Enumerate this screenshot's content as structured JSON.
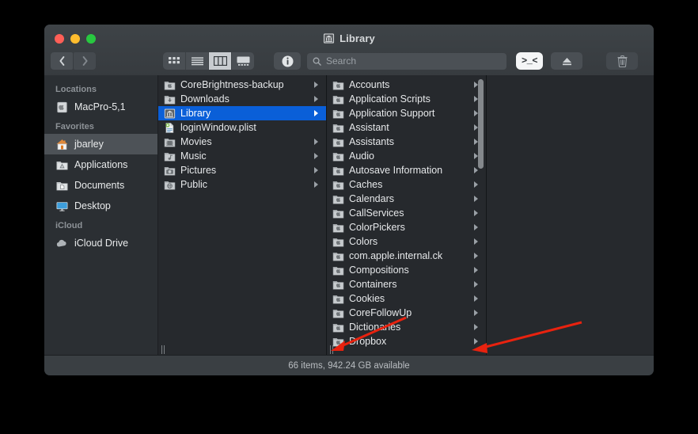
{
  "window": {
    "title": "Library",
    "title_icon": "library-building-icon",
    "traffic_lights": [
      "close",
      "minimize",
      "zoom"
    ]
  },
  "toolbar": {
    "back_label": "Back",
    "forward_label": "Forward",
    "views": [
      {
        "name": "icon-view",
        "active": false
      },
      {
        "name": "list-view",
        "active": false
      },
      {
        "name": "column-view",
        "active": true
      },
      {
        "name": "gallery-view",
        "active": false
      }
    ],
    "info_label": "Info",
    "search_placeholder": "Search",
    "terminal_label": ">_<",
    "eject_label": "Eject",
    "trash_label": "Delete"
  },
  "sidebar": {
    "sections": [
      {
        "header": "Locations",
        "items": [
          {
            "label": "MacPro-5,1",
            "icon": "macpro-icon",
            "selected": false
          }
        ]
      },
      {
        "header": "Favorites",
        "items": [
          {
            "label": "jbarley",
            "icon": "home-icon",
            "selected": true
          },
          {
            "label": "Applications",
            "icon": "applications-folder-icon",
            "selected": false
          },
          {
            "label": "Documents",
            "icon": "documents-folder-icon",
            "selected": false
          },
          {
            "label": "Desktop",
            "icon": "desktop-display-icon",
            "selected": false
          }
        ]
      },
      {
        "header": "iCloud",
        "items": [
          {
            "label": "iCloud Drive",
            "icon": "cloud-icon",
            "selected": false
          }
        ]
      }
    ]
  },
  "columns": [
    {
      "name": "column-home",
      "items": [
        {
          "label": "CoreBrightness-backup",
          "icon": "apple-folder-icon",
          "disclosure": true,
          "selected": false
        },
        {
          "label": "Downloads",
          "icon": "downloads-folder-icon",
          "disclosure": true,
          "selected": false
        },
        {
          "label": "Library",
          "icon": "library-building-icon",
          "disclosure": true,
          "selected": true
        },
        {
          "label": "loginWindow.plist",
          "icon": "plist-file-icon",
          "disclosure": false,
          "selected": false
        },
        {
          "label": "Movies",
          "icon": "movies-folder-icon",
          "disclosure": true,
          "selected": false
        },
        {
          "label": "Music",
          "icon": "music-folder-icon",
          "disclosure": true,
          "selected": false
        },
        {
          "label": "Pictures",
          "icon": "pictures-folder-icon",
          "disclosure": true,
          "selected": false
        },
        {
          "label": "Public",
          "icon": "public-folder-icon",
          "disclosure": true,
          "selected": false
        }
      ]
    },
    {
      "name": "column-library",
      "scrollbar": true,
      "items": [
        {
          "label": "Accounts",
          "icon": "apple-folder-icon",
          "disclosure": true,
          "selected": false
        },
        {
          "label": "Application Scripts",
          "icon": "apple-folder-icon",
          "disclosure": true,
          "selected": false
        },
        {
          "label": "Application Support",
          "icon": "apple-folder-icon",
          "disclosure": true,
          "selected": false
        },
        {
          "label": "Assistant",
          "icon": "apple-folder-icon",
          "disclosure": true,
          "selected": false
        },
        {
          "label": "Assistants",
          "icon": "apple-folder-icon",
          "disclosure": true,
          "selected": false
        },
        {
          "label": "Audio",
          "icon": "apple-folder-icon",
          "disclosure": true,
          "selected": false
        },
        {
          "label": "Autosave Information",
          "icon": "apple-folder-icon",
          "disclosure": true,
          "selected": false
        },
        {
          "label": "Caches",
          "icon": "apple-folder-icon",
          "disclosure": true,
          "selected": false
        },
        {
          "label": "Calendars",
          "icon": "apple-folder-icon",
          "disclosure": true,
          "selected": false
        },
        {
          "label": "CallServices",
          "icon": "apple-folder-icon",
          "disclosure": true,
          "selected": false
        },
        {
          "label": "ColorPickers",
          "icon": "apple-folder-icon",
          "disclosure": true,
          "selected": false
        },
        {
          "label": "Colors",
          "icon": "apple-folder-icon",
          "disclosure": true,
          "selected": false
        },
        {
          "label": "com.apple.internal.ck",
          "icon": "apple-folder-icon",
          "disclosure": true,
          "selected": false
        },
        {
          "label": "Compositions",
          "icon": "apple-folder-icon",
          "disclosure": true,
          "selected": false
        },
        {
          "label": "Containers",
          "icon": "apple-folder-icon",
          "disclosure": true,
          "selected": false
        },
        {
          "label": "Cookies",
          "icon": "apple-folder-icon",
          "disclosure": true,
          "selected": false
        },
        {
          "label": "CoreFollowUp",
          "icon": "apple-folder-icon",
          "disclosure": true,
          "selected": false
        },
        {
          "label": "Dictionaries",
          "icon": "apple-folder-icon",
          "disclosure": true,
          "selected": false
        },
        {
          "label": "Dropbox",
          "icon": "apple-folder-icon",
          "disclosure": true,
          "selected": false
        }
      ]
    },
    {
      "name": "column-preview",
      "items": []
    }
  ],
  "statusbar": {
    "text": "66 items, 942.24 GB available"
  },
  "annotations": {
    "arrow_color": "#e8220f",
    "arrows": [
      {
        "name": "arrow-to-column-divider-left"
      },
      {
        "name": "arrow-to-column-resize-handle"
      }
    ]
  },
  "colors": {
    "selection_blue": "#0a5fd8",
    "window_chrome": "#3a3f43",
    "sidebar_bg": "#2b2f33",
    "column_bg": "#26292d",
    "desktop_bg": "#000000"
  }
}
